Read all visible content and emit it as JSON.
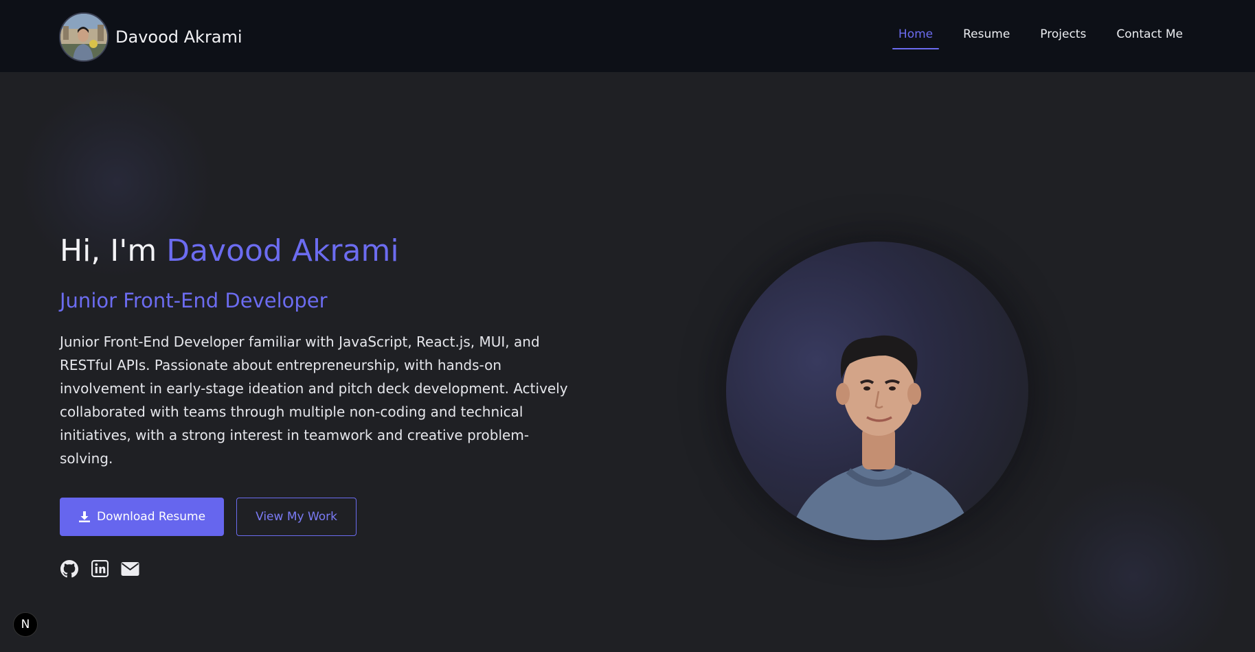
{
  "brand": {
    "name": "Davood Akrami",
    "avatar_icon": "profile-photo-avatar"
  },
  "nav": {
    "items": [
      {
        "label": "Home",
        "active": true
      },
      {
        "label": "Resume",
        "active": false
      },
      {
        "label": "Projects",
        "active": false
      },
      {
        "label": "Contact Me",
        "active": false
      }
    ]
  },
  "hero": {
    "greeting_prefix": "Hi, I'm ",
    "greeting_name": "Davood Akrami",
    "role": "Junior Front-End Developer",
    "description": "Junior Front-End Developer familiar with JavaScript, React.js, MUI, and RESTful APIs. Passionate about entrepreneurship, with hands-on involvement in early-stage ideation and pitch deck development. Actively collaborated with teams through multiple non-coding and technical initiatives, with a strong interest in teamwork and creative problem-solving.",
    "primary_button": "Download Resume",
    "secondary_button": "View My Work",
    "socials": [
      "github-icon",
      "linkedin-icon",
      "email-icon"
    ],
    "portrait_icon": "portrait-photo"
  },
  "dev_badge": {
    "label": "N"
  },
  "colors": {
    "accent": "#6c6cf0",
    "background": "#1f2024",
    "header_background": "#0d1017"
  }
}
